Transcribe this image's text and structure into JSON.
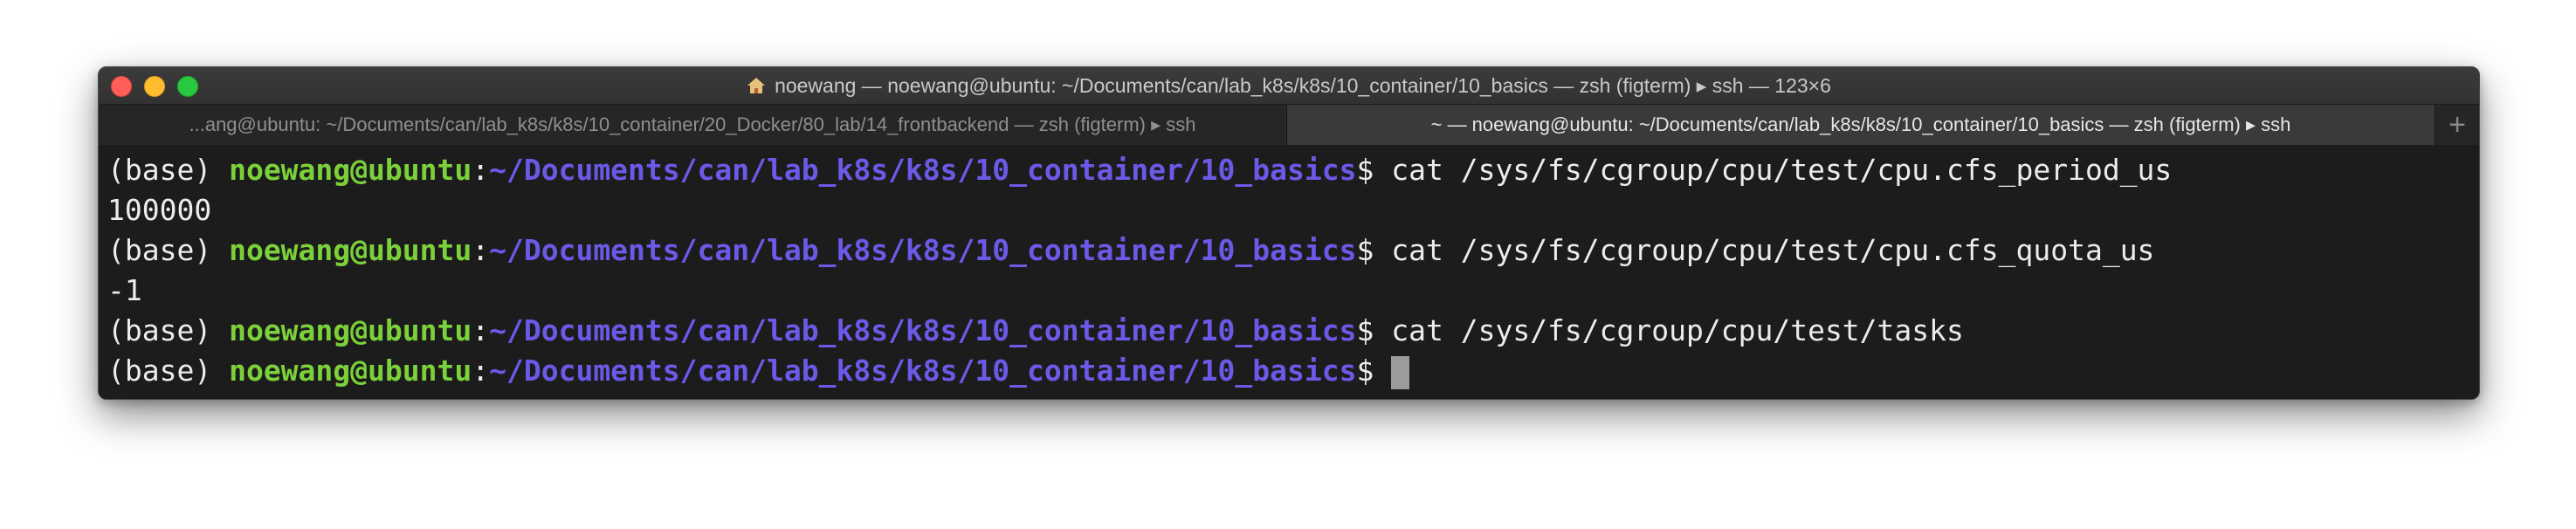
{
  "window": {
    "title": "noewang — noewang@ubuntu: ~/Documents/can/lab_k8s/k8s/10_container/10_basics — zsh (figterm) ▸ ssh — 123×6"
  },
  "tabs": [
    {
      "label": "...ang@ubuntu: ~/Documents/can/lab_k8s/k8s/10_container/20_Docker/80_lab/14_frontbackend — zsh (figterm) ▸ ssh",
      "active": false
    },
    {
      "label": "~ — noewang@ubuntu: ~/Documents/can/lab_k8s/k8s/10_container/10_basics — zsh (figterm) ▸ ssh",
      "active": true
    }
  ],
  "new_tab_label": "+",
  "terminal": {
    "prompt": {
      "env": "(base) ",
      "user": "noewang@ubuntu",
      "colon": ":",
      "path": "~/Documents/can/lab_k8s/k8s/10_container/10_basics",
      "symbol": "$ "
    },
    "lines": [
      {
        "type": "cmd",
        "command": "cat /sys/fs/cgroup/cpu/test/cpu.cfs_period_us"
      },
      {
        "type": "out",
        "text": "100000"
      },
      {
        "type": "cmd",
        "command": "cat /sys/fs/cgroup/cpu/test/cpu.cfs_quota_us"
      },
      {
        "type": "out",
        "text": "-1"
      },
      {
        "type": "cmd",
        "command": "cat /sys/fs/cgroup/cpu/test/tasks"
      },
      {
        "type": "cmd",
        "command": ""
      }
    ]
  },
  "colors": {
    "user": "#7bd13a",
    "path": "#6b5ae8",
    "text": "#ececec",
    "background": "#1c1c1c"
  },
  "icons": {
    "title": "home-icon",
    "traffic_lights": [
      "close-icon",
      "minimize-icon",
      "zoom-icon"
    ]
  }
}
